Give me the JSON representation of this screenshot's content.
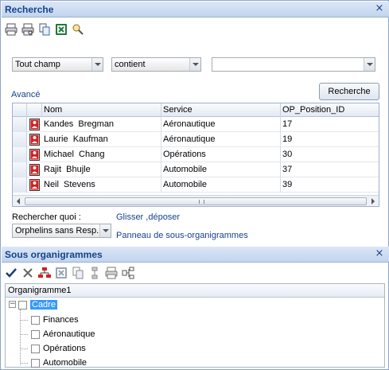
{
  "search_panel": {
    "title": "Recherche",
    "close_glyph": "×",
    "toolbar": [
      {
        "name": "print-icon"
      },
      {
        "name": "print-preview-icon"
      },
      {
        "name": "copy-icon"
      },
      {
        "name": "excel-icon"
      },
      {
        "name": "find-icon"
      }
    ],
    "field_combo": "Tout champ",
    "operator_combo": "contient",
    "value_combo": "",
    "advanced_link": "Avancé",
    "search_button": "Recherche",
    "columns": [
      "Nom",
      "Service",
      "OP_Position_ID"
    ],
    "rows": [
      {
        "nom": "Kandes  Bregman",
        "service": "Aéronautique",
        "id": "17"
      },
      {
        "nom": "Laurie  Kaufman",
        "service": "Aéronautique",
        "id": "19"
      },
      {
        "nom": "Michael  Chang",
        "service": "Opérations",
        "id": "30"
      },
      {
        "nom": "Rajit  Bhujle",
        "service": "Automobile",
        "id": "37"
      },
      {
        "nom": "Neil  Stevens",
        "service": "Automobile",
        "id": "39"
      }
    ],
    "search_for_label": "Rechercher quoi :",
    "search_for_value": "Orphelins sans Resp.",
    "drag_drop_link": "Glisser ,déposer",
    "subchart_panel_link": "Panneau de sous-organigrammes"
  },
  "sub_panel": {
    "title": "Sous organigrammes",
    "close_glyph": "×",
    "toolbar": [
      {
        "name": "check-icon"
      },
      {
        "name": "delete-icon"
      },
      {
        "name": "org-chart-icon"
      },
      {
        "name": "excel-icon"
      },
      {
        "name": "copy-icon"
      },
      {
        "name": "align-icon"
      },
      {
        "name": "print-icon"
      },
      {
        "name": "layout-icon"
      }
    ],
    "tree_header": "Organigramme1",
    "tree": {
      "root": "Cadre",
      "expander": "−",
      "children": [
        "Finances",
        "Aéronautique",
        "Opérations",
        "Automobile"
      ]
    }
  },
  "colors": {
    "header_text": "#15428b",
    "link": "#15428b",
    "selection": "#3399ff",
    "person_icon": "#d42020"
  }
}
